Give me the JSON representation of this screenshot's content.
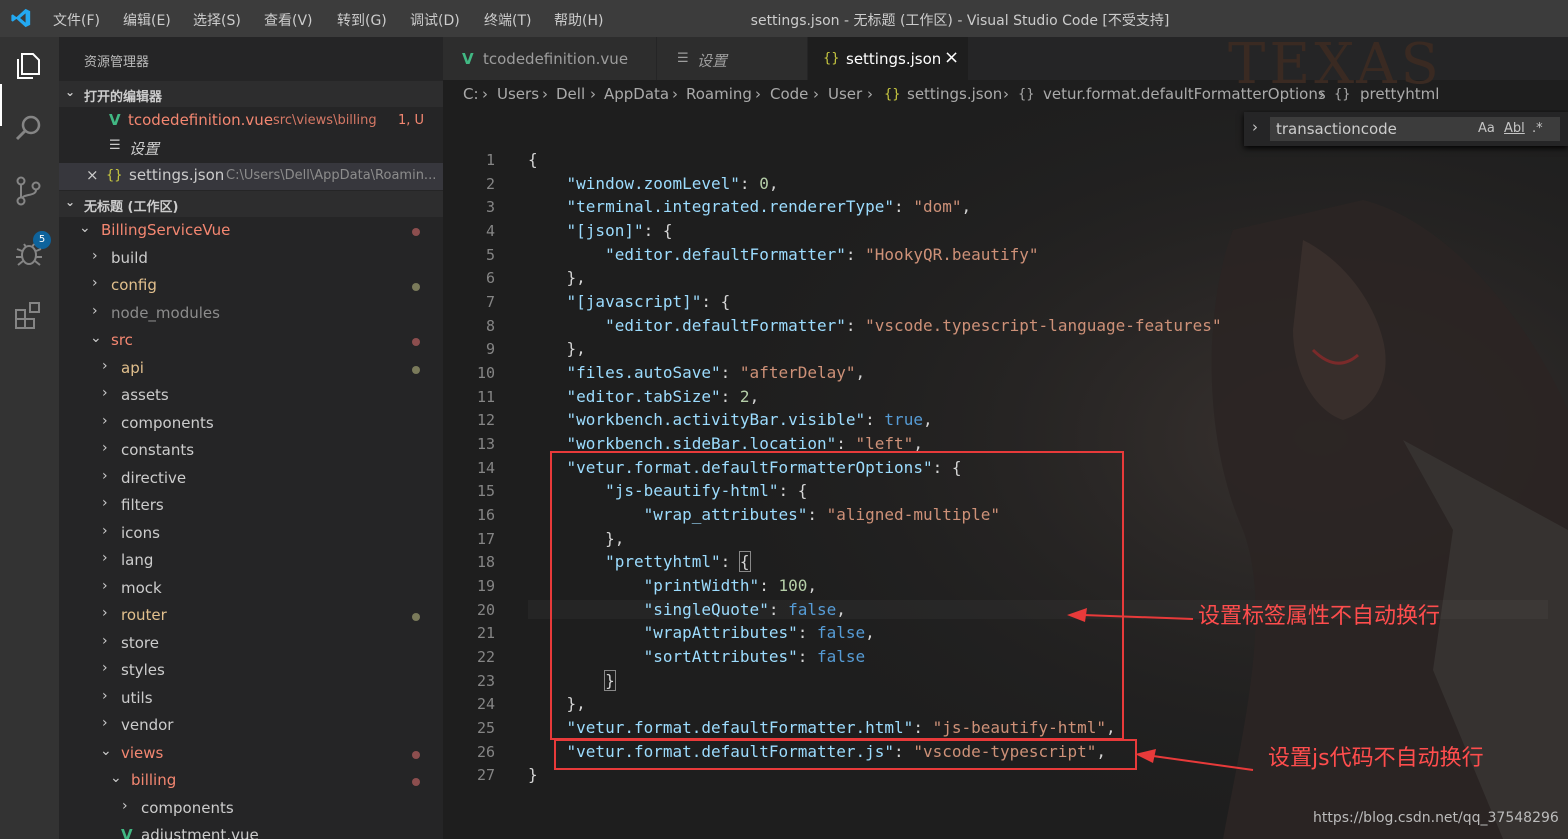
{
  "titlebar": {
    "menus": [
      "文件(F)",
      "编辑(E)",
      "选择(S)",
      "查看(V)",
      "转到(G)",
      "调试(D)",
      "终端(T)",
      "帮助(H)"
    ],
    "title": "settings.json - 无标题 (工作区) - Visual Studio Code [不受支持]"
  },
  "activitybar": {
    "icons": [
      "explorer-icon",
      "search-icon",
      "source-control-icon",
      "debug-icon",
      "extensions-icon"
    ],
    "scm_badge": "5"
  },
  "sidebar": {
    "title": "资源管理器",
    "open_editors": {
      "header": "打开的编辑器",
      "items": [
        {
          "name": "tcodedefinition.vue",
          "path": "src\\views\\billing",
          "status": "1, U"
        },
        {
          "name": "设置",
          "path": "",
          "status": ""
        },
        {
          "name": "settings.json",
          "path": "C:\\Users\\Dell\\AppData\\Roamin...",
          "status": ""
        }
      ]
    },
    "workspace": {
      "header": "无标题 (工作区)",
      "tree": [
        "BillingServiceVue",
        "build",
        "config",
        "node_modules",
        "src",
        "api",
        "assets",
        "components",
        "constants",
        "directive",
        "filters",
        "icons",
        "lang",
        "mock",
        "router",
        "store",
        "styles",
        "utils",
        "vendor",
        "views",
        "billing",
        "components",
        "adjustment.vue"
      ]
    }
  },
  "tabs": [
    {
      "label": "tcodedefinition.vue",
      "icon": "vue-icon"
    },
    {
      "label": "设置",
      "icon": "settings-list-icon"
    },
    {
      "label": "settings.json",
      "icon": "json-braces-icon",
      "active": true
    }
  ],
  "breadcrumb": [
    "C:",
    "Users",
    "Dell",
    "AppData",
    "Roaming",
    "Code",
    "User",
    "settings.json",
    "vetur.format.defaultFormatterOptions",
    "prettyhtml"
  ],
  "find": {
    "value": "transactioncode",
    "options": [
      "Aa",
      "Abl",
      ".*"
    ]
  },
  "editor": {
    "line_numbers": [
      "1",
      "2",
      "3",
      "4",
      "5",
      "6",
      "7",
      "8",
      "9",
      "10",
      "11",
      "12",
      "13",
      "14",
      "15",
      "16",
      "17",
      "18",
      "19",
      "20",
      "21",
      "22",
      "23",
      "24",
      "25",
      "26",
      "27"
    ],
    "tokens": {
      "l1_brace": "{",
      "l2_key": "\"window.zoomLevel\"",
      "l2_val": "0",
      "l3_key": "\"terminal.integrated.rendererType\"",
      "l3_val": "\"dom\"",
      "l4_key": "\"[json]\"",
      "l5_key": "\"editor.defaultFormatter\"",
      "l5_val": "\"HookyQR.beautify\"",
      "l6_close": "},",
      "l7_key": "\"[javascript]\"",
      "l8_key": "\"editor.defaultFormatter\"",
      "l8_val": "\"vscode.typescript-language-features\"",
      "l9_close": "},",
      "l10_key": "\"files.autoSave\"",
      "l10_val": "\"afterDelay\"",
      "l11_key": "\"editor.tabSize\"",
      "l11_val": "2",
      "l12_key": "\"workbench.activityBar.visible\"",
      "l12_val": "true",
      "l13_key": "\"workbench.sideBar.location\"",
      "l13_val": "\"left\"",
      "l14_key": "\"vetur.format.defaultFormatterOptions\"",
      "l15_key": "\"js-beautify-html\"",
      "l16_key": "\"wrap_attributes\"",
      "l16_val": "\"aligned-multiple\"",
      "l17_close": "},",
      "l18_key": "\"prettyhtml\"",
      "l19_key": "\"printWidth\"",
      "l19_val": "100",
      "l20_key": "\"singleQuote\"",
      "l20_val": "false",
      "l21_key": "\"wrapAttributes\"",
      "l21_val": "false",
      "l22_key": "\"sortAttributes\"",
      "l22_val": "false",
      "l23_close": "}",
      "l24_close": "},",
      "l25_key": "\"vetur.format.defaultFormatter.html\"",
      "l25_val": "\"js-beautify-html\"",
      "l26_key": "\"vetur.format.defaultFormatter.js\"",
      "l26_val": "\"vscode-typescript\"",
      "l27_close": "}"
    }
  },
  "annotations": {
    "tag_attr_note": "设置标签属性不自动换行",
    "js_note": "设置js代码不自动换行"
  },
  "background_art_text": "TEXAS",
  "watermark": "https://blog.csdn.net/qq_37548296",
  "colors": {
    "accent": "#007acc",
    "annotation_red": "#e83a3a",
    "vue_green": "#41b883",
    "json_yellow": "#cbcb41"
  }
}
